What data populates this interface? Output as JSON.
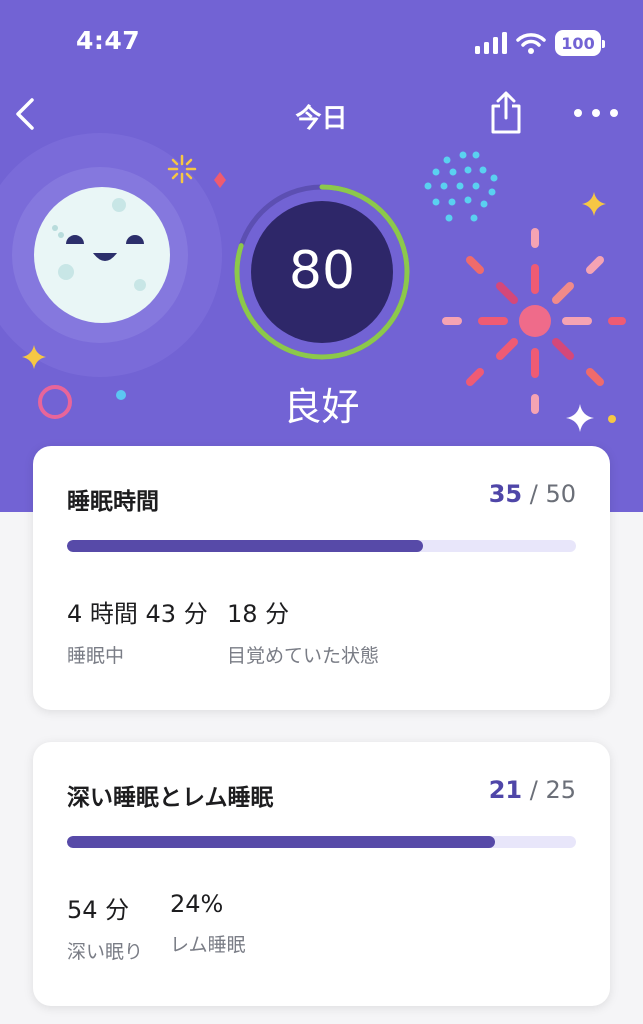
{
  "status": {
    "time": "4:47",
    "battery": "100"
  },
  "nav": {
    "title": "今日"
  },
  "score": {
    "value": "80",
    "label": "良好",
    "fraction": 0.8
  },
  "cards": [
    {
      "title": "睡眠時間",
      "score": "35",
      "max": "50",
      "progress": 0.7,
      "stats": [
        {
          "value": "4 時間 43 分",
          "label": "睡眠中"
        },
        {
          "value": "18 分",
          "label": "目覚めていた状態"
        }
      ]
    },
    {
      "title": "深い睡眠とレム睡眠",
      "score": "21",
      "max": "25",
      "progress": 0.84,
      "stats": [
        {
          "value": "54 分",
          "label": "深い眠り"
        },
        {
          "value": "24%",
          "label": "レム睡眠"
        }
      ]
    }
  ],
  "colors": {
    "hero": "#7263d4",
    "ring": "#8cc84b",
    "bar": "#574aa8",
    "accent": "#4f46a8"
  },
  "icons": [
    "back-chevron-icon",
    "share-icon",
    "more-icon",
    "moon-mascot-icon",
    "fireworks-icon"
  ]
}
